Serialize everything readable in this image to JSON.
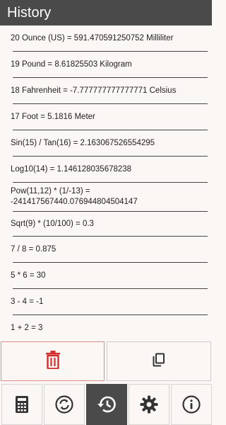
{
  "header": {
    "title": "History"
  },
  "history": [
    {
      "text": "20 Ounce (US) = 591.470591250752 Milliliter"
    },
    {
      "text": "19 Pound = 8.61825503 Kilogram"
    },
    {
      "text": "18 Fahrenheit = -7.777777777777771 Celsius"
    },
    {
      "text": "17 Foot = 5.1816 Meter"
    },
    {
      "text": "Sin(15) / Tan(16) = 2.163067526554295"
    },
    {
      "text": "Log10(14) = 1.146128035678238"
    },
    {
      "text": "Pow(11,12) * (1/-13) = -241417567440.076944804504147"
    },
    {
      "text": "Sqrt(9) * (10/100) = 0.3"
    },
    {
      "text": "7 / 8 = 0.875"
    },
    {
      "text": "5 * 6 = 30"
    },
    {
      "text": "3 - 4 = -1"
    },
    {
      "text": "1 + 2 = 3"
    }
  ],
  "actions": {
    "delete_icon": "trash-icon",
    "copy_icon": "copy-icon",
    "delete_color": "#d32f2f"
  },
  "nav": [
    {
      "icon": "calculator-icon",
      "active": false
    },
    {
      "icon": "convert-icon",
      "active": false
    },
    {
      "icon": "history-icon",
      "active": true
    },
    {
      "icon": "settings-icon",
      "active": false
    },
    {
      "icon": "info-icon",
      "active": false
    }
  ]
}
